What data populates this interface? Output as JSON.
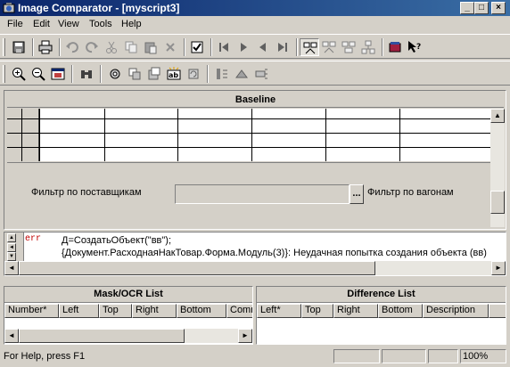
{
  "window": {
    "title": "Image Comparator - [myscript3]",
    "min_glyph": "_",
    "max_glyph": "□",
    "close_glyph": "×"
  },
  "menu": {
    "items": [
      "File",
      "Edit",
      "View",
      "Tools",
      "Help"
    ]
  },
  "toolbar1": {
    "icons": [
      "save-icon",
      "print-icon",
      "undo-icon",
      "redo-icon",
      "cut-icon",
      "copy-icon",
      "paste-icon",
      "delete-icon",
      "properties-icon",
      "first-icon",
      "next-icon",
      "previous-icon",
      "last-icon",
      "compare-mode-1-icon",
      "compare-mode-2-icon",
      "compare-mode-3-icon",
      "compare-mode-4-icon",
      "book-icon",
      "context-help-icon"
    ]
  },
  "toolbar2": {
    "icons": [
      "zoom-in-icon",
      "zoom-out-icon",
      "fit-window-icon",
      "binoculars-icon",
      "mask-settings-icon",
      "mask-add-icon",
      "mask-remove-icon",
      "ocr-icon",
      "mask-cycle-icon",
      "region-1-icon",
      "region-2-icon",
      "region-3-icon"
    ]
  },
  "baseline": {
    "title": "Baseline",
    "filter_supplier_label": "Фильтр по поставщикам",
    "filter_wagon_label": "Фильтр по вагонам",
    "ellipsis": "..."
  },
  "output": {
    "tag": "err",
    "lines": [
      "Д=СоздатьОбъект(\"вв\");",
      "{Документ.РасходнаяНакТовар.Форма.Модуль(3)}: Неудачная попытка создания объекта (вв)"
    ]
  },
  "mask_list": {
    "title": "Mask/OCR List",
    "columns": [
      "Number*",
      "Left",
      "Top",
      "Right",
      "Bottom",
      "Comm"
    ]
  },
  "difference_list": {
    "title": "Difference List",
    "columns": [
      "Left*",
      "Top",
      "Right",
      "Bottom",
      "Description"
    ]
  },
  "status": {
    "text": "For Help, press F1",
    "zoom": "100%"
  },
  "colors": {
    "titlebar_start": "#0a246a",
    "titlebar_end": "#3a6ea5",
    "face": "#d4d0c8",
    "error": "#c00000"
  }
}
